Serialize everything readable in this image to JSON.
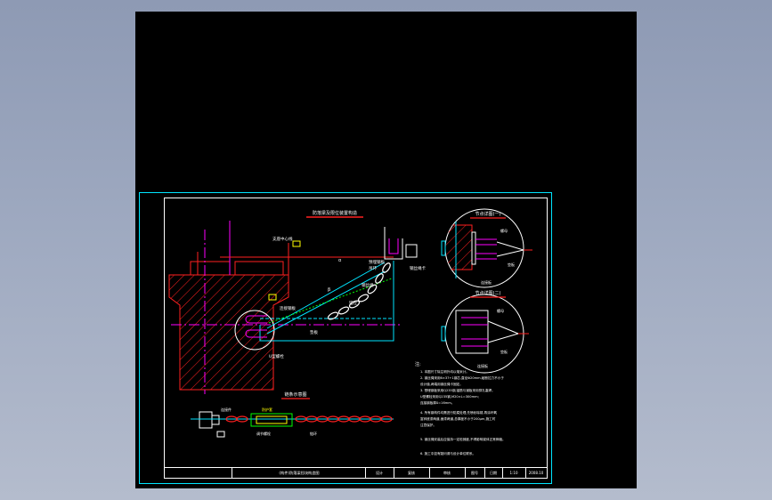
{
  "drawing": {
    "title_block": {
      "drawing_name": "(构件)防落梁挡块构造图",
      "cells": [
        "设计",
        "复核",
        "审核",
        "图号",
        "日期",
        "1:10"
      ],
      "drawing_no": "2008.10"
    },
    "main_view": {
      "title": "防落梁及限位装置构造",
      "labels": [
        "支座中心线",
        "预埋钢板",
        "锚栓",
        "连接钢板",
        "垫板",
        "U型螺栓",
        "钢丝绳",
        "吊环",
        "钢丝绳卡",
        "α",
        "β"
      ]
    },
    "detail_one": {
      "title": "节点详图(一)",
      "labels": [
        "螺母",
        "垫板",
        "连接板"
      ]
    },
    "detail_two": {
      "title": "节点详图(二)",
      "labels": [
        "螺母",
        "垫板",
        "连接板"
      ]
    },
    "chain_view": {
      "title": "链条示意图",
      "labels": [
        "防护套",
        "连接件",
        "调节螺栓",
        "链环"
      ]
    },
    "notes": {
      "heading": "注:",
      "lines": [
        "1. 本图尺寸除注明外均以毫米计。",
        "2. 钢丝绳采用6×37+1钢芯,直径Φ20mm,破断拉力不小于",
        "   设计值,两端用钢丝绳卡固定。",
        "3. 预埋钢板采用Q235钢,锚筋与钢板采用穿孔塞焊。",
        "   U型螺栓采用Q235钢,M20×L=300mm;",
        "   连接钢板厚δ=16mm。",
        "4. 所有钢构件均需进行防腐处理,先喷砂除锈,再涂环氧",
        "   富锌底漆两道,面漆两道,总厚度不小于200μm,施工时",
        "   注意保护。",
        "5. 钢丝绳安装后应保持一定松弛度,不得影响梁体正常伸缩。",
        "6. 施工中如有疑问请与设计单位联系。"
      ]
    },
    "colors": {
      "frame": "#00e5ff",
      "structure": "#ff2020",
      "line": "#00e5ff",
      "chain": "#ffffff",
      "text": "#ffffff",
      "dimension": "#00ff00",
      "accent": "#ff00ff",
      "title_underline": "#ff2020",
      "highlight": "#ffff00"
    }
  }
}
